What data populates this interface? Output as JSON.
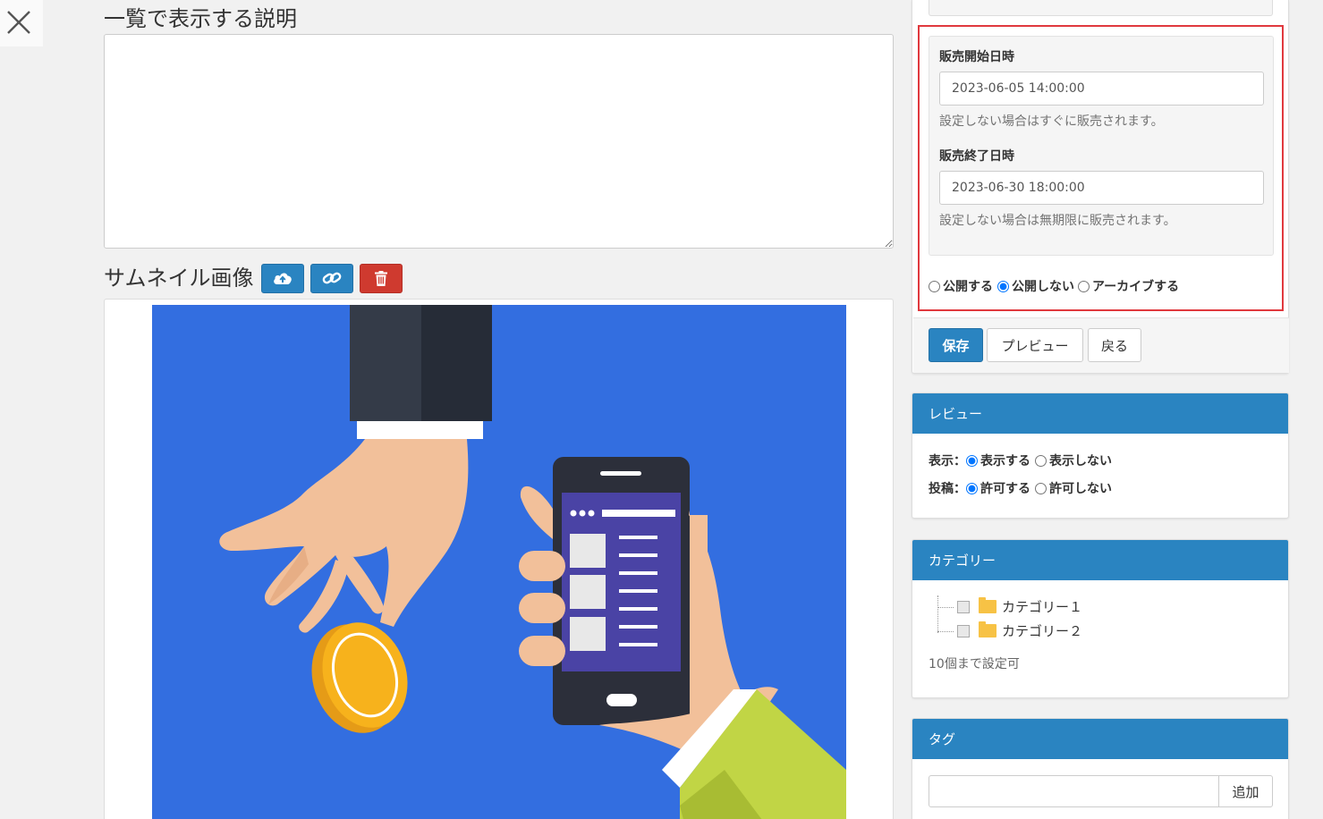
{
  "close": {
    "icon": "close-icon"
  },
  "description": {
    "heading": "一覧で表示する説明",
    "value": ""
  },
  "thumbnail": {
    "heading": "サムネイル画像",
    "buttons": [
      {
        "icon": "cloud-upload-icon",
        "color": "#2a84c1"
      },
      {
        "icon": "link-icon",
        "color": "#2a84c1"
      },
      {
        "icon": "trash-icon",
        "color": "#cf3a2f"
      }
    ],
    "image": {
      "subject": "hand-giving-coin-to-hand-holding-smartphone",
      "background": "#336ee0"
    }
  },
  "publish": {
    "sale_start": {
      "label": "販売開始日時",
      "value": "2023-06-05 14:00:00",
      "help": "設定しない場合はすぐに販売されます。"
    },
    "sale_end": {
      "label": "販売終了日時",
      "value": "2023-06-30 18:00:00",
      "help": "設定しない場合は無期限に販売されます。"
    },
    "status_options": [
      {
        "label": "公開する",
        "checked": false
      },
      {
        "label": "公開しない",
        "checked": true
      },
      {
        "label": "アーカイブする",
        "checked": false
      }
    ],
    "highlight_color": "#e0393e",
    "buttons": {
      "save": "保存",
      "preview": "プレビュー",
      "back": "戻る"
    }
  },
  "review": {
    "title": "レビュー",
    "display": {
      "label": "表示：",
      "options": [
        {
          "label": "表示する",
          "checked": true
        },
        {
          "label": "表示しない",
          "checked": false
        }
      ]
    },
    "posting": {
      "label": "投稿：",
      "options": [
        {
          "label": "許可する",
          "checked": true
        },
        {
          "label": "許可しない",
          "checked": false
        }
      ]
    }
  },
  "category": {
    "title": "カテゴリー",
    "items": [
      {
        "label": "カテゴリー１",
        "icon": "folder-icon"
      },
      {
        "label": "カテゴリー２",
        "icon": "folder-icon"
      }
    ],
    "help": "10個まで設定可"
  },
  "tag": {
    "title": "タグ",
    "input_value": "",
    "add_label": "追加"
  },
  "colors": {
    "primary": "#2a84c1",
    "danger": "#cf3a2f",
    "panel_head": "#2a84c1"
  }
}
